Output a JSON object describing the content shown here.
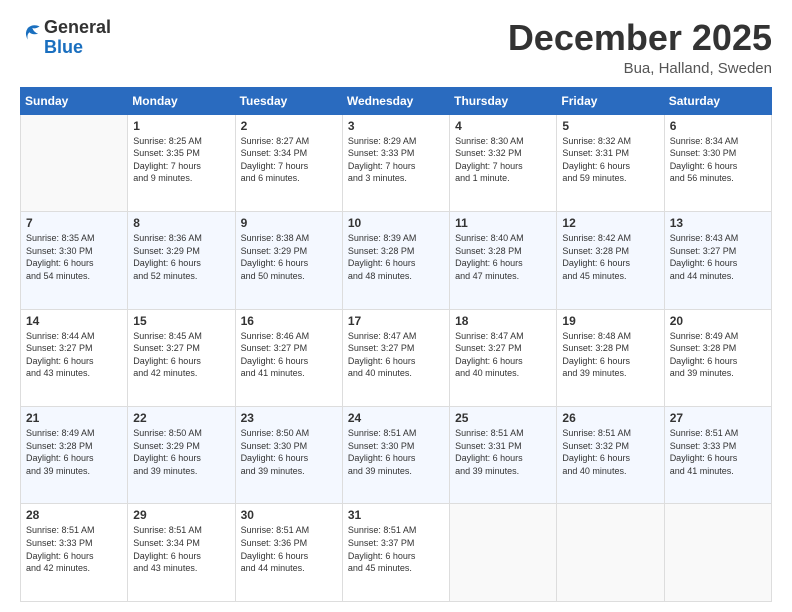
{
  "header": {
    "logo_general": "General",
    "logo_blue": "Blue",
    "month_title": "December 2025",
    "location": "Bua, Halland, Sweden"
  },
  "days_of_week": [
    "Sunday",
    "Monday",
    "Tuesday",
    "Wednesday",
    "Thursday",
    "Friday",
    "Saturday"
  ],
  "weeks": [
    [
      {
        "day": "",
        "info": ""
      },
      {
        "day": "1",
        "info": "Sunrise: 8:25 AM\nSunset: 3:35 PM\nDaylight: 7 hours\nand 9 minutes."
      },
      {
        "day": "2",
        "info": "Sunrise: 8:27 AM\nSunset: 3:34 PM\nDaylight: 7 hours\nand 6 minutes."
      },
      {
        "day": "3",
        "info": "Sunrise: 8:29 AM\nSunset: 3:33 PM\nDaylight: 7 hours\nand 3 minutes."
      },
      {
        "day": "4",
        "info": "Sunrise: 8:30 AM\nSunset: 3:32 PM\nDaylight: 7 hours\nand 1 minute."
      },
      {
        "day": "5",
        "info": "Sunrise: 8:32 AM\nSunset: 3:31 PM\nDaylight: 6 hours\nand 59 minutes."
      },
      {
        "day": "6",
        "info": "Sunrise: 8:34 AM\nSunset: 3:30 PM\nDaylight: 6 hours\nand 56 minutes."
      }
    ],
    [
      {
        "day": "7",
        "info": "Sunrise: 8:35 AM\nSunset: 3:30 PM\nDaylight: 6 hours\nand 54 minutes."
      },
      {
        "day": "8",
        "info": "Sunrise: 8:36 AM\nSunset: 3:29 PM\nDaylight: 6 hours\nand 52 minutes."
      },
      {
        "day": "9",
        "info": "Sunrise: 8:38 AM\nSunset: 3:29 PM\nDaylight: 6 hours\nand 50 minutes."
      },
      {
        "day": "10",
        "info": "Sunrise: 8:39 AM\nSunset: 3:28 PM\nDaylight: 6 hours\nand 48 minutes."
      },
      {
        "day": "11",
        "info": "Sunrise: 8:40 AM\nSunset: 3:28 PM\nDaylight: 6 hours\nand 47 minutes."
      },
      {
        "day": "12",
        "info": "Sunrise: 8:42 AM\nSunset: 3:28 PM\nDaylight: 6 hours\nand 45 minutes."
      },
      {
        "day": "13",
        "info": "Sunrise: 8:43 AM\nSunset: 3:27 PM\nDaylight: 6 hours\nand 44 minutes."
      }
    ],
    [
      {
        "day": "14",
        "info": "Sunrise: 8:44 AM\nSunset: 3:27 PM\nDaylight: 6 hours\nand 43 minutes."
      },
      {
        "day": "15",
        "info": "Sunrise: 8:45 AM\nSunset: 3:27 PM\nDaylight: 6 hours\nand 42 minutes."
      },
      {
        "day": "16",
        "info": "Sunrise: 8:46 AM\nSunset: 3:27 PM\nDaylight: 6 hours\nand 41 minutes."
      },
      {
        "day": "17",
        "info": "Sunrise: 8:47 AM\nSunset: 3:27 PM\nDaylight: 6 hours\nand 40 minutes."
      },
      {
        "day": "18",
        "info": "Sunrise: 8:47 AM\nSunset: 3:27 PM\nDaylight: 6 hours\nand 40 minutes."
      },
      {
        "day": "19",
        "info": "Sunrise: 8:48 AM\nSunset: 3:28 PM\nDaylight: 6 hours\nand 39 minutes."
      },
      {
        "day": "20",
        "info": "Sunrise: 8:49 AM\nSunset: 3:28 PM\nDaylight: 6 hours\nand 39 minutes."
      }
    ],
    [
      {
        "day": "21",
        "info": "Sunrise: 8:49 AM\nSunset: 3:28 PM\nDaylight: 6 hours\nand 39 minutes."
      },
      {
        "day": "22",
        "info": "Sunrise: 8:50 AM\nSunset: 3:29 PM\nDaylight: 6 hours\nand 39 minutes."
      },
      {
        "day": "23",
        "info": "Sunrise: 8:50 AM\nSunset: 3:30 PM\nDaylight: 6 hours\nand 39 minutes."
      },
      {
        "day": "24",
        "info": "Sunrise: 8:51 AM\nSunset: 3:30 PM\nDaylight: 6 hours\nand 39 minutes."
      },
      {
        "day": "25",
        "info": "Sunrise: 8:51 AM\nSunset: 3:31 PM\nDaylight: 6 hours\nand 39 minutes."
      },
      {
        "day": "26",
        "info": "Sunrise: 8:51 AM\nSunset: 3:32 PM\nDaylight: 6 hours\nand 40 minutes."
      },
      {
        "day": "27",
        "info": "Sunrise: 8:51 AM\nSunset: 3:33 PM\nDaylight: 6 hours\nand 41 minutes."
      }
    ],
    [
      {
        "day": "28",
        "info": "Sunrise: 8:51 AM\nSunset: 3:33 PM\nDaylight: 6 hours\nand 42 minutes."
      },
      {
        "day": "29",
        "info": "Sunrise: 8:51 AM\nSunset: 3:34 PM\nDaylight: 6 hours\nand 43 minutes."
      },
      {
        "day": "30",
        "info": "Sunrise: 8:51 AM\nSunset: 3:36 PM\nDaylight: 6 hours\nand 44 minutes."
      },
      {
        "day": "31",
        "info": "Sunrise: 8:51 AM\nSunset: 3:37 PM\nDaylight: 6 hours\nand 45 minutes."
      },
      {
        "day": "",
        "info": ""
      },
      {
        "day": "",
        "info": ""
      },
      {
        "day": "",
        "info": ""
      }
    ]
  ]
}
